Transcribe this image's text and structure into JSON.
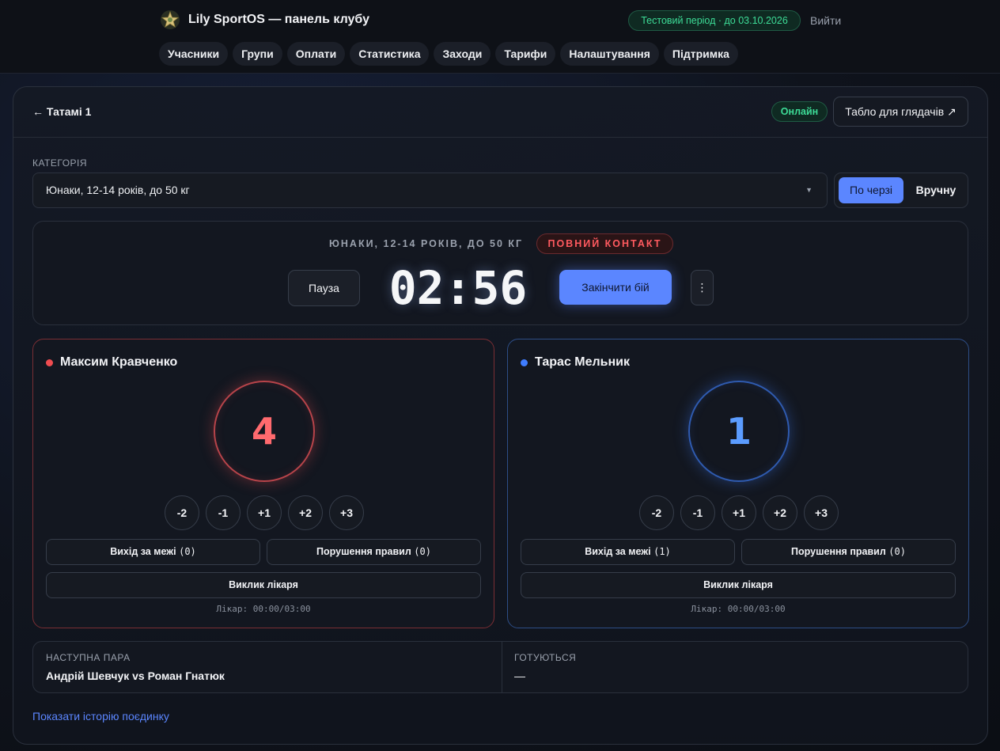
{
  "header": {
    "brand_title": "Lily SportOS — панель клубу",
    "logo_icon": "star-emblem-icon",
    "trial_badge": "Тестовий період · до 03.10.2026",
    "logout": "Вийти",
    "nav": [
      "Учасники",
      "Групи",
      "Оплати",
      "Статистика",
      "Заходи",
      "Тарифи",
      "Налаштування",
      "Підтримка"
    ]
  },
  "panel": {
    "back": "← Татамі 1",
    "status": "Онлайн",
    "viewer_button": "Табло для глядачів ↗",
    "category_label": "КАТЕГОРІЯ",
    "category_value": "Юнаки, 12-14 років, до 50 кг",
    "mode": {
      "queue": "По черзі",
      "manual": "Вручну",
      "selected": "queue"
    },
    "timer": {
      "category": "ЮНАКИ, 12-14 РОКІВ, ДО 50 КГ",
      "type": "ПОВНИЙ КОНТАКТ",
      "pause": "Пауза",
      "clock": "02:56",
      "end": "Закінчити бій",
      "more": "⋮"
    },
    "point_buttons": [
      "-2",
      "-1",
      "+1",
      "+2",
      "+3"
    ],
    "fighters": {
      "red": {
        "name": "Максим Кравченко",
        "score": "4",
        "out_label": "Вихід за межі",
        "out_count": "(0)",
        "foul_label": "Порушення правил",
        "foul_count": "(0)",
        "doctor": "Виклик лікаря",
        "doctor_time": "Лікар: 00:00/03:00"
      },
      "blue": {
        "name": "Тарас Мельник",
        "score": "1",
        "out_label": "Вихід за межі",
        "out_count": "(1)",
        "foul_label": "Порушення правил",
        "foul_count": "(0)",
        "doctor": "Виклик лікаря",
        "doctor_time": "Лікар: 00:00/03:00"
      }
    },
    "next": {
      "label": "НАСТУПНА ПАРА",
      "value": "Андрій Шевчук vs Роман Гнатюк",
      "ready_label": "ГОТУЮТЬСЯ",
      "ready_value": "—"
    },
    "history_link": "Показати історію поєдинку"
  },
  "colors": {
    "accent": "#5b86ff",
    "online": "#3ddc97",
    "red_corner": "#ef4c50",
    "blue_corner": "#3f7dff"
  }
}
